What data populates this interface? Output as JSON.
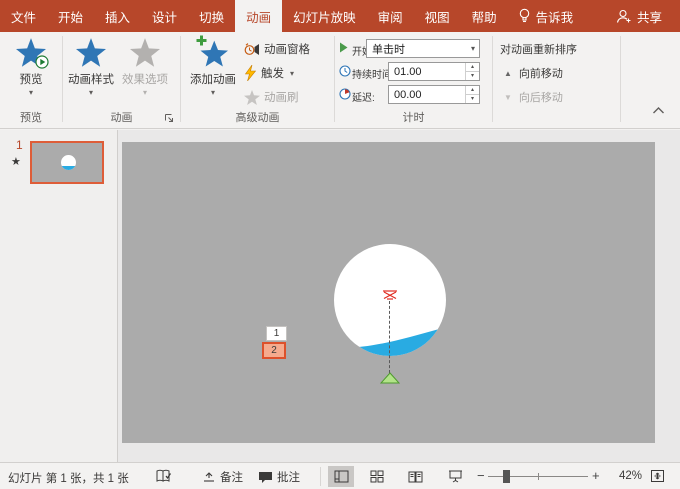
{
  "colors": {
    "accent": "#B7472A",
    "ribbon_bg": "#F3F2F1",
    "slide_bg": "#ABABAB",
    "water_blue": "#29ABE2",
    "selection_orange": "#DE5D38",
    "star_blue": "#2F76B5",
    "disabled_gray": "#B3B1AF"
  },
  "icons": {
    "dropdown_arrow": "▾",
    "spin_up": "▴",
    "spin_down": "▾",
    "move_earlier_arrow": "▲",
    "move_later_arrow": "▼",
    "slide_star": "★",
    "zoom_out": "−",
    "zoom_in": "+"
  },
  "menubar": {
    "tabs": [
      {
        "label": "文件"
      },
      {
        "label": "开始"
      },
      {
        "label": "插入"
      },
      {
        "label": "设计"
      },
      {
        "label": "切换"
      },
      {
        "label": "动画"
      },
      {
        "label": "幻灯片放映"
      },
      {
        "label": "审阅"
      },
      {
        "label": "视图"
      },
      {
        "label": "帮助"
      }
    ],
    "selected_tab": "动画",
    "tell_me": "告诉我",
    "share": "共享"
  },
  "ribbon": {
    "preview": {
      "button": "预览",
      "group_label": "预览"
    },
    "animation": {
      "styles_button": "动画样式",
      "effect_options_button": "效果选项",
      "group_label": "动画"
    },
    "advanced": {
      "add_button": "添加动画",
      "pane_button": "动画窗格",
      "trigger_button": "触发",
      "painter_button": "动画刷",
      "group_label": "高级动画"
    },
    "timing": {
      "start_label": "开始:",
      "start_value": "单击时",
      "duration_label": "持续时间:",
      "duration_value": "01.00",
      "delay_label": "延迟:",
      "delay_value": "00.00",
      "group_label": "计时"
    },
    "reorder": {
      "title": "对动画重新排序",
      "move_earlier": "向前移动",
      "move_later": "向后移动"
    }
  },
  "thumbnail_panel": {
    "slide_number": "1"
  },
  "slide": {
    "animation_badges": [
      {
        "number": "1",
        "selected": false
      },
      {
        "number": "2",
        "selected": true
      }
    ]
  },
  "statusbar": {
    "slide_info": "幻灯片 第 1 张，共 1 张",
    "notes_label": "备注",
    "comments_label": "批注",
    "zoom_level": "42%"
  }
}
